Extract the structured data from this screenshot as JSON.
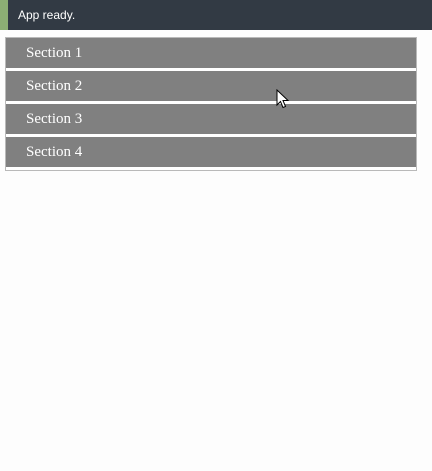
{
  "status": {
    "message": "App ready.",
    "accent_color": "#8cae74",
    "background_color": "#323a44"
  },
  "accordion": {
    "header_color": "#808080",
    "sections": [
      {
        "label": "Section 1"
      },
      {
        "label": "Section 2"
      },
      {
        "label": "Section 3"
      },
      {
        "label": "Section 4"
      }
    ]
  },
  "cursor": {
    "icon": "mouse-pointer-icon"
  }
}
